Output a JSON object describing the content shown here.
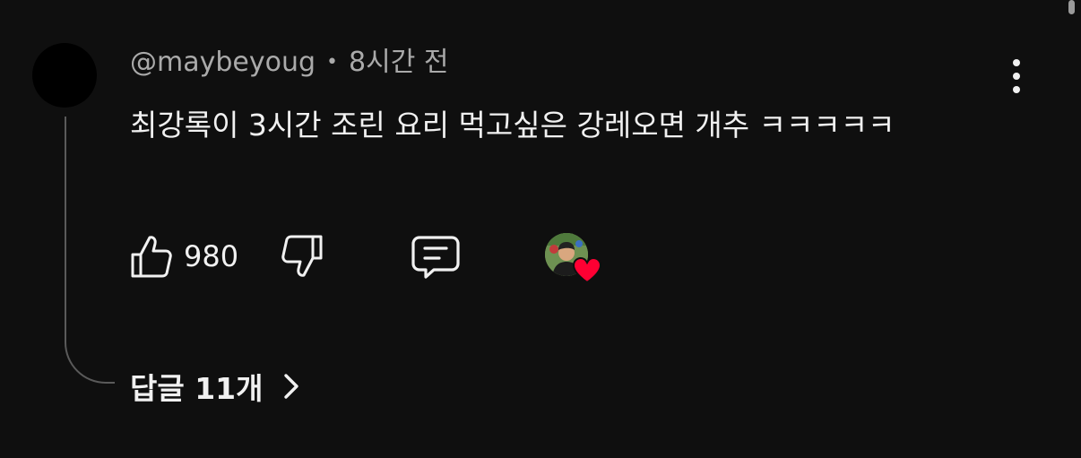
{
  "comment": {
    "author": "@maybeyoug",
    "separator": "•",
    "time": "8시간 전",
    "text": "최강록이 3시간 조린 요리 먹고싶은 강레오면 개추 ㅋㅋㅋㅋㅋ",
    "like_count": "980"
  },
  "replies": {
    "label": "답글 11개"
  },
  "icons": {
    "like": "thumbs-up-icon",
    "dislike": "thumbs-down-icon",
    "reply": "comment-icon",
    "more": "more-vert-icon",
    "heart": "heart-icon",
    "chevron": "chevron-right-icon"
  },
  "colors": {
    "background": "#0f0f0f",
    "text": "#f1f1f1",
    "secondary_text": "#aaaaaa",
    "heart": "#ff0033"
  }
}
